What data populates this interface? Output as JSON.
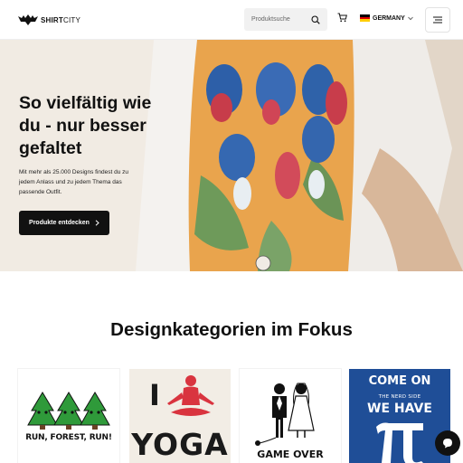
{
  "header": {
    "logo": {
      "bold": "SHIRT",
      "thin": "CITY"
    },
    "search": {
      "placeholder": "Produktsuche"
    },
    "country": {
      "label": "GERMANY",
      "flag_colors": [
        "#000000",
        "#dd0000",
        "#ffce00"
      ]
    }
  },
  "hero": {
    "title": "So vielfältig wie du - nur besser gefaltet",
    "subtitle": "Mit mehr als 25.000 Designs findest du zu jedem Anlass und zu jedem Thema das passende Outfit.",
    "cta_label": "Produkte entdecken"
  },
  "categories": {
    "title": "Designkategorien im Fokus",
    "cards": [
      {
        "text": "RUN, FOREST, RUN!"
      },
      {
        "letter": "I",
        "text": "YOGA"
      },
      {
        "text": "GAME OVER"
      },
      {
        "line1": "COME ON",
        "line2": "THE NERD SIDE",
        "line3": "WE HAVE"
      }
    ]
  },
  "colors": {
    "accent": "#111111",
    "shirt_orange": "#e9a44d",
    "card_blue": "#1f4e97"
  }
}
